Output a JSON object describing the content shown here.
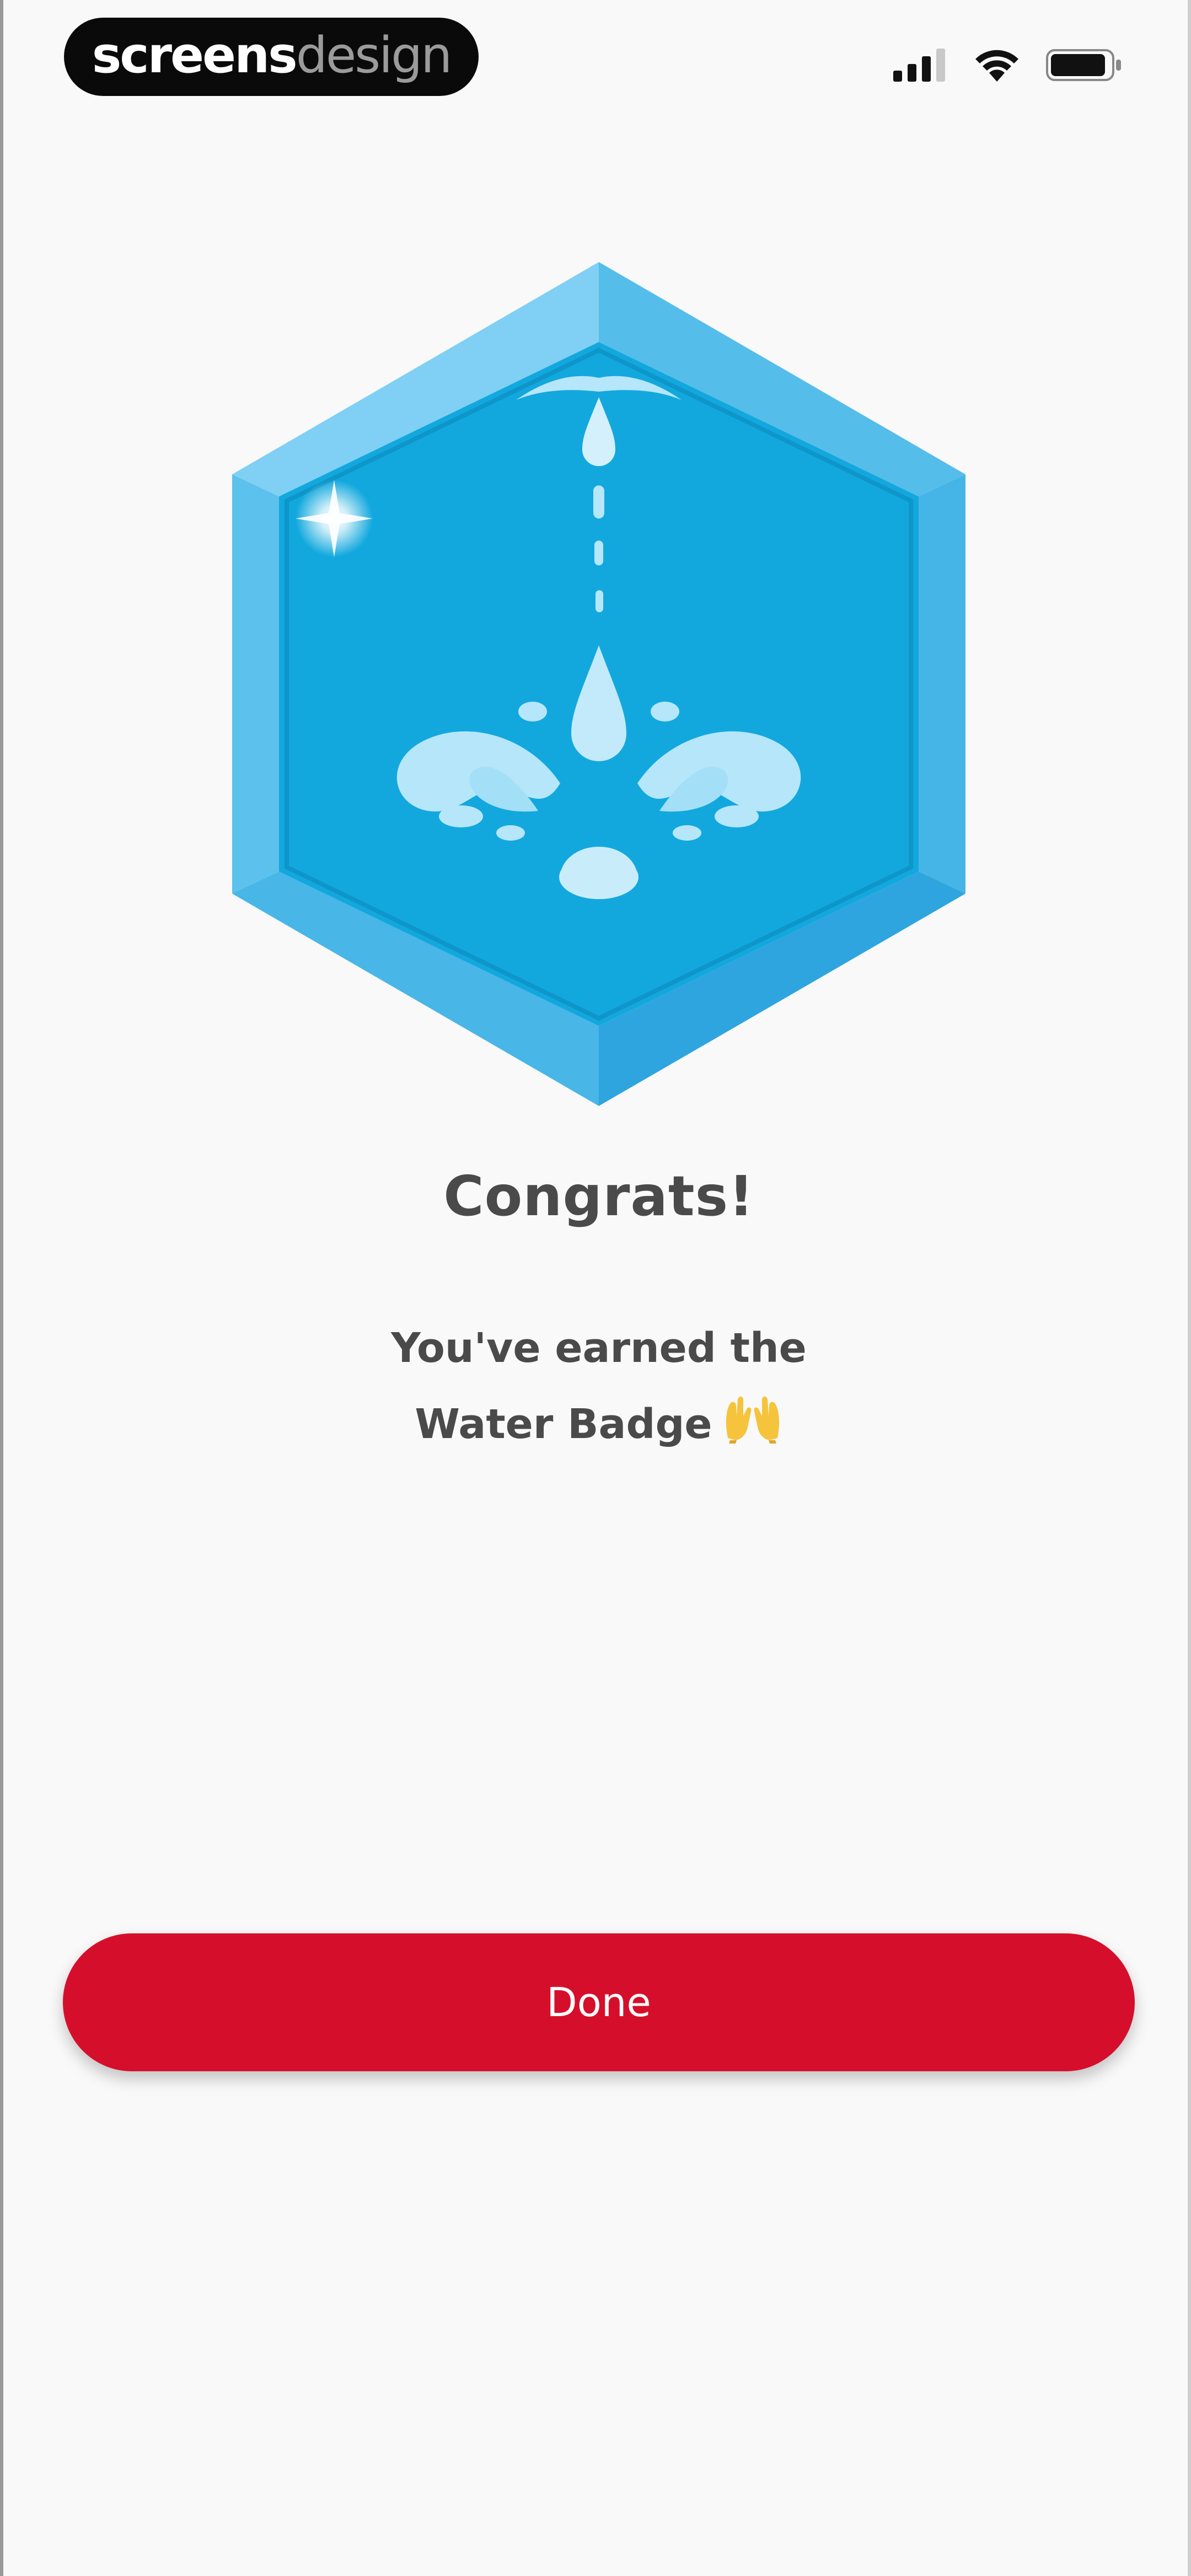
{
  "status_bar": {
    "brand_bold": "screens",
    "brand_light": "design",
    "icons": [
      "signal-icon",
      "wifi-icon",
      "battery-icon"
    ]
  },
  "badge": {
    "icon": "water-badge-icon",
    "colors": {
      "outer_light": "#7fd0f4",
      "outer_mid": "#55bdea",
      "outer_dark": "#2ea5de",
      "inner": "#12a8de",
      "water": "#b6e6fa"
    }
  },
  "content": {
    "title": "Congrats!",
    "message_line1": "You've earned the",
    "message_line2": "Water Badge",
    "emoji_icon": "raising-hands-icon"
  },
  "actions": {
    "done_label": "Done",
    "done_color": "#d50f2b"
  }
}
